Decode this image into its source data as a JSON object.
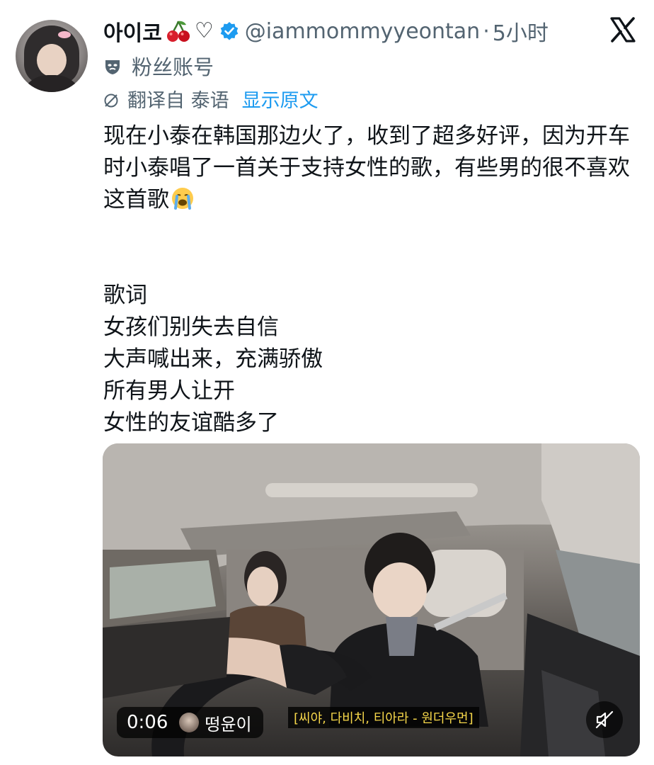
{
  "author": {
    "display_name": "아이코",
    "name_emoji_1": "cherry-icon",
    "name_emoji_2": "♡",
    "verified": true,
    "handle": "@iammommyyeontan",
    "separator": "·",
    "timestamp": "5小时",
    "fan_label": "粉丝账号"
  },
  "translation": {
    "label": "翻译自 泰语",
    "show_original": "显示原文"
  },
  "body": {
    "paragraph_1": "现在小泰在韩国那边火了，收到了超多好评，因为开车时小泰唱了一首关于支持女性的歌，有些男的很不喜欢这首歌",
    "lyrics_title": "歌词",
    "lyrics": [
      "女孩们别失去自信",
      "大声喊出来，充满骄傲",
      "所有男人让开",
      "女性的友谊酷多了"
    ]
  },
  "video": {
    "elapsed": "0:06",
    "channel_name": "떵윤이",
    "subtitle": "[씨야, 다비치, 티아라 - 원더우먼]",
    "muted": true
  },
  "colors": {
    "text_primary": "#0f1419",
    "text_secondary": "#536471",
    "link": "#1d9bf0",
    "caption_yellow": "#f7d84a"
  }
}
